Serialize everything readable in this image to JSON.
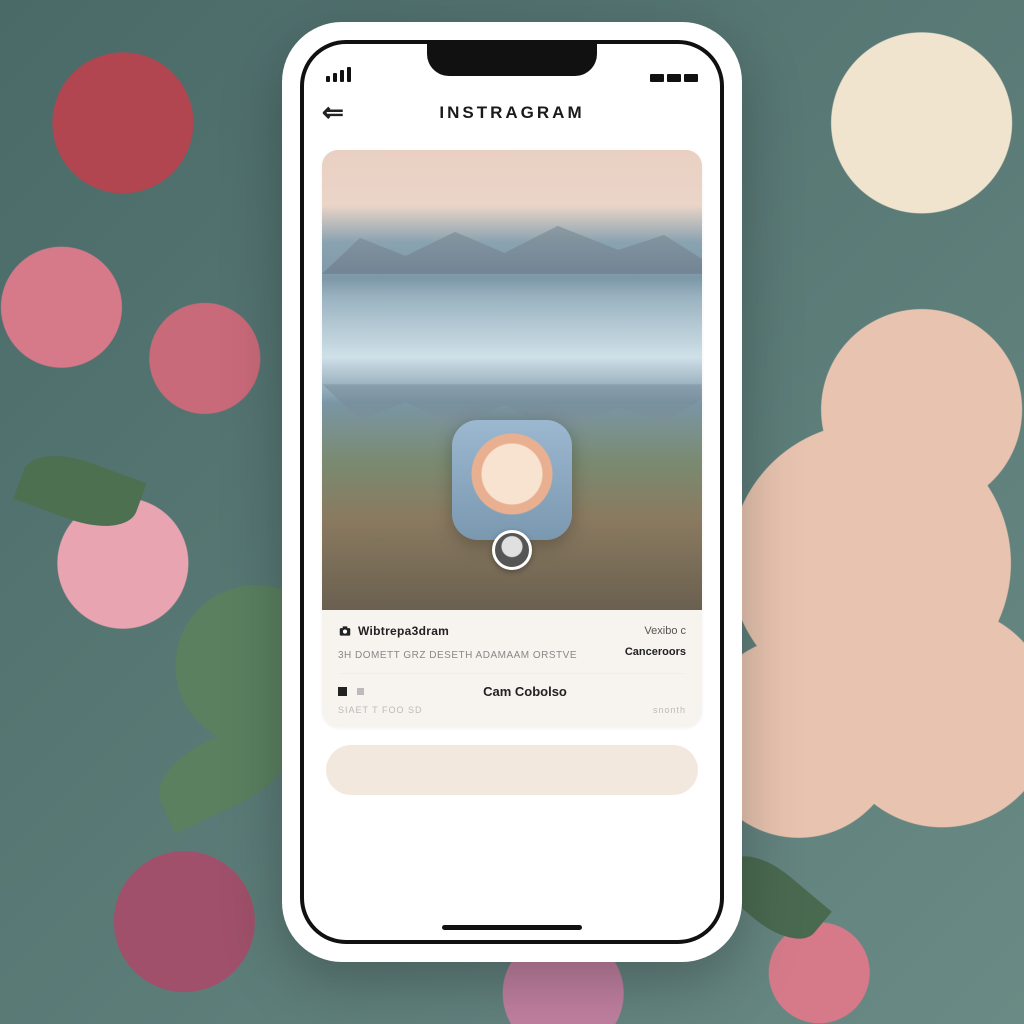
{
  "header": {
    "back_glyph": "⇐",
    "title": "INSTRAGRAM"
  },
  "post": {
    "username": "Wibtrepa3dram",
    "right_tag": "Vexibo c",
    "caption": "3H DOMETT   GRZ DESETH ADAMAAM ORSTVE",
    "action_label": "Canceroors"
  },
  "comment": {
    "user": "Cam Cobolso",
    "left_small": "SIAET T FOO SD",
    "right_small": "snonth"
  },
  "input": {
    "placeholder": ""
  },
  "icons": {
    "camera": "camera-icon",
    "back": "back-icon",
    "avatar": "avatar-icon"
  },
  "colors": {
    "card_bg": "#f7f3ef",
    "input_bg": "#f3e8de",
    "text": "#1a1a1a"
  }
}
